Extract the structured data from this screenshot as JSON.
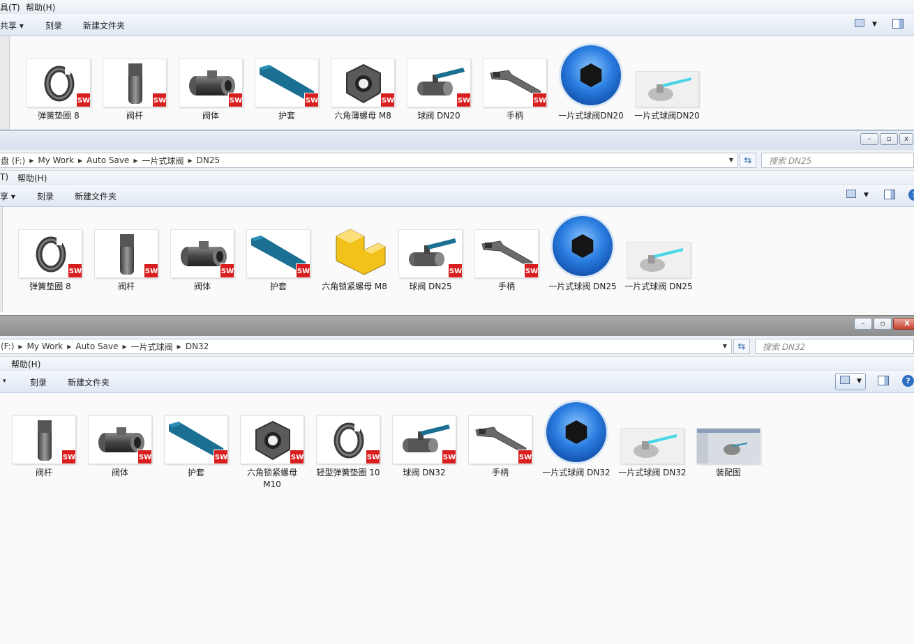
{
  "window1": {
    "menu": {
      "tools": "具(T)",
      "help": "帮助(H)"
    },
    "commands": {
      "share": "共享 ▾",
      "burn": "刻录",
      "new_folder": "新建文件夹"
    },
    "files": [
      {
        "name": "弹簧垫圈 8",
        "kind": "sw",
        "shape": "ring"
      },
      {
        "name": "阀杆",
        "kind": "sw",
        "shape": "stem"
      },
      {
        "name": "阀体",
        "kind": "sw",
        "shape": "body"
      },
      {
        "name": "护套",
        "kind": "sw",
        "shape": "sleeve"
      },
      {
        "name": "六角薄螺母 M8",
        "kind": "sw",
        "shape": "nut"
      },
      {
        "name": "球阀 DN20",
        "kind": "sw",
        "shape": "valve"
      },
      {
        "name": "手柄",
        "kind": "sw",
        "shape": "handle"
      },
      {
        "name": "一片式球阀DN20",
        "kind": "keyshot",
        "shape": "keyshot"
      },
      {
        "name": "一片式球阀DN20",
        "kind": "render",
        "shape": "render"
      }
    ]
  },
  "window2": {
    "breadcrumb": [
      "盘 (F:)",
      "My Work",
      "Auto Save",
      "一片式球阀",
      "DN25"
    ],
    "search_placeholder": "搜索 DN25",
    "menu": {
      "tools": "T)",
      "help": "帮助(H)"
    },
    "commands": {
      "share": "享 ▾",
      "burn": "刻录",
      "new_folder": "新建文件夹"
    },
    "files": [
      {
        "name": "弹簧垫圈 8",
        "kind": "sw",
        "shape": "ring"
      },
      {
        "name": "阀杆",
        "kind": "sw",
        "shape": "stem"
      },
      {
        "name": "阀体",
        "kind": "sw",
        "shape": "body"
      },
      {
        "name": "护套",
        "kind": "sw",
        "shape": "sleeve"
      },
      {
        "name": "六角锁紧螺母 M8",
        "kind": "part",
        "shape": "part"
      },
      {
        "name": "球阀 DN25",
        "kind": "sw",
        "shape": "valve"
      },
      {
        "name": "手柄",
        "kind": "sw",
        "shape": "handle"
      },
      {
        "name": "一片式球阀 DN25",
        "kind": "keyshot",
        "shape": "keyshot"
      },
      {
        "name": "一片式球阀 DN25",
        "kind": "render",
        "shape": "render"
      }
    ]
  },
  "window3": {
    "breadcrumb": [
      "(F:)",
      "My Work",
      "Auto Save",
      "一片式球阀",
      "DN32"
    ],
    "search_placeholder": "搜索 DN32",
    "menu": {
      "help": "帮助(H)"
    },
    "commands": {
      "share": "▾",
      "burn": "刻录",
      "new_folder": "新建文件夹"
    },
    "files": [
      {
        "name": "阀杆",
        "kind": "sw",
        "shape": "stem"
      },
      {
        "name": "阀体",
        "kind": "sw",
        "shape": "body"
      },
      {
        "name": "护套",
        "kind": "sw",
        "shape": "sleeve"
      },
      {
        "name": "六角锁紧螺母 M10",
        "kind": "sw",
        "shape": "nut"
      },
      {
        "name": "轻型弹簧垫圈 10",
        "kind": "sw",
        "shape": "ring"
      },
      {
        "name": "球阀 DN32",
        "kind": "sw",
        "shape": "valve"
      },
      {
        "name": "手柄",
        "kind": "sw",
        "shape": "handle"
      },
      {
        "name": "一片式球阀 DN32",
        "kind": "keyshot",
        "shape": "keyshot"
      },
      {
        "name": "一片式球阀 DN32",
        "kind": "render",
        "shape": "render"
      },
      {
        "name": "装配图",
        "kind": "screenshot",
        "shape": "screenshot"
      }
    ]
  },
  "badge_text": "SW",
  "colors": {
    "sw_red": "#d81e1e",
    "sleeve_blue": "#1a6f93",
    "keyshot_blue": "#2a7de0",
    "part_yellow": "#f2c21b"
  }
}
